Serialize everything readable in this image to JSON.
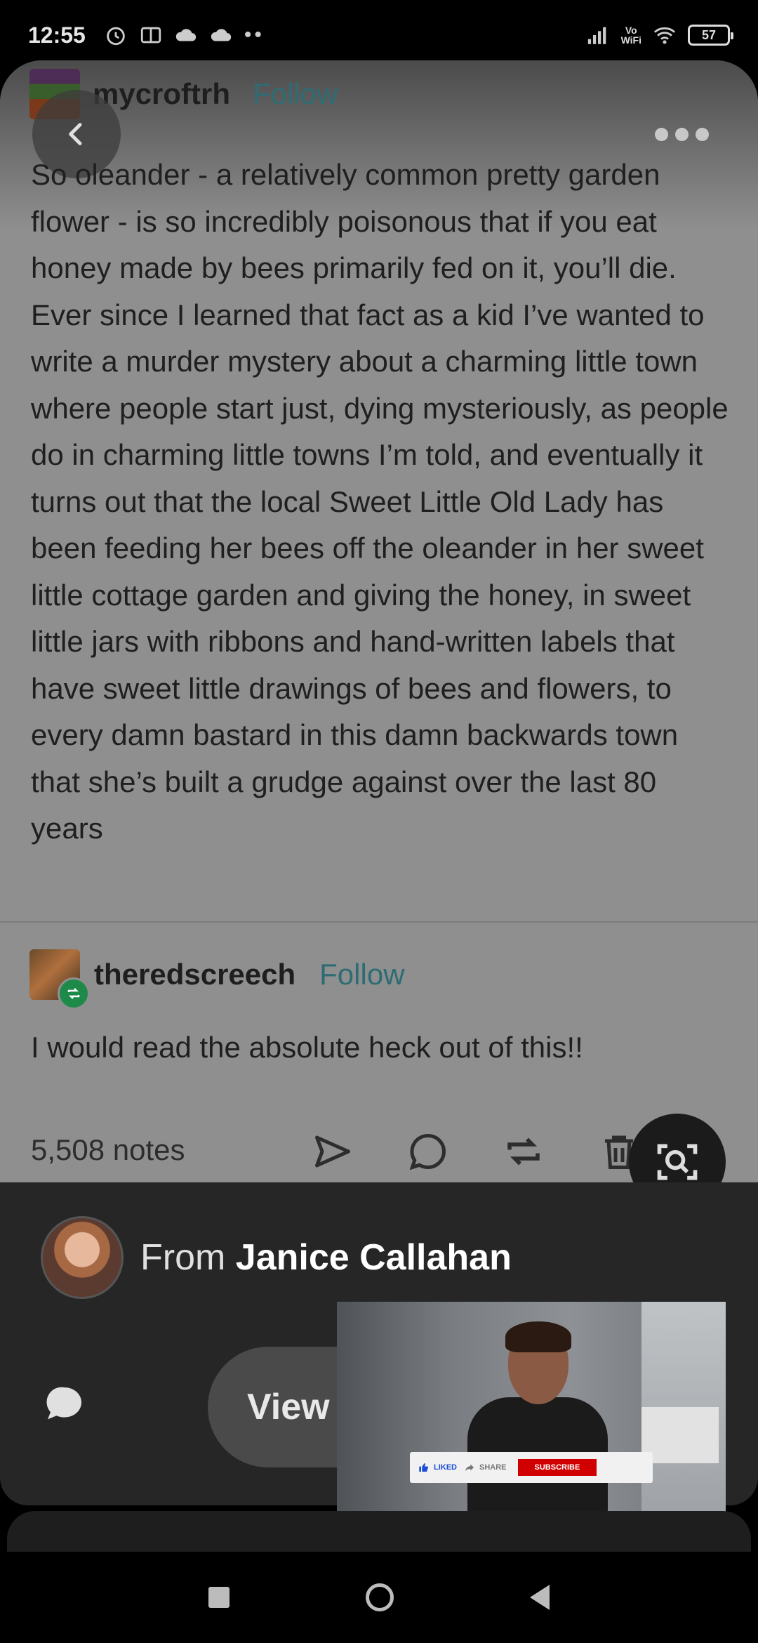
{
  "status_bar": {
    "time": "12:55",
    "network": "Vo\nWiFi",
    "battery": "57"
  },
  "post": {
    "author": "mycroftrh",
    "follow_label": "Follow",
    "body": "So oleander - a relatively common pretty garden flower - is so incredibly poisonous that if you eat honey made by bees primarily fed on it, you’ll die.  Ever since I learned that fact as a kid I’ve wanted to write a murder mystery about a charming little town where people start just, dying mysteriously, as people do in charming little towns I’m told, and eventually it turns out that the local Sweet Little Old Lady has been feeding her bees off the oleander in her sweet little cottage garden and giving the honey, in sweet little jars with ribbons and hand-written labels that have sweet little drawings of bees and flowers, to every damn bastard in this damn backwards town that she’s built a grudge against over the last 80 years"
  },
  "reblog": {
    "author": "theredscreech",
    "follow_label": "Follow",
    "text": "I would read the absolute heck out of this!!"
  },
  "notes": {
    "count": "5,508 notes"
  },
  "sheet": {
    "from_prefix": "From",
    "from_name": "Janice Callahan",
    "view_label": "View"
  },
  "video": {
    "liked_label": "LIKED",
    "share_label": "SHARE",
    "subscribe_label": "SUBSCRIBE"
  },
  "colors": {
    "follow": "#2e6c74",
    "reblog_badge": "#1e8a4a",
    "subscribe": "#d10000"
  }
}
